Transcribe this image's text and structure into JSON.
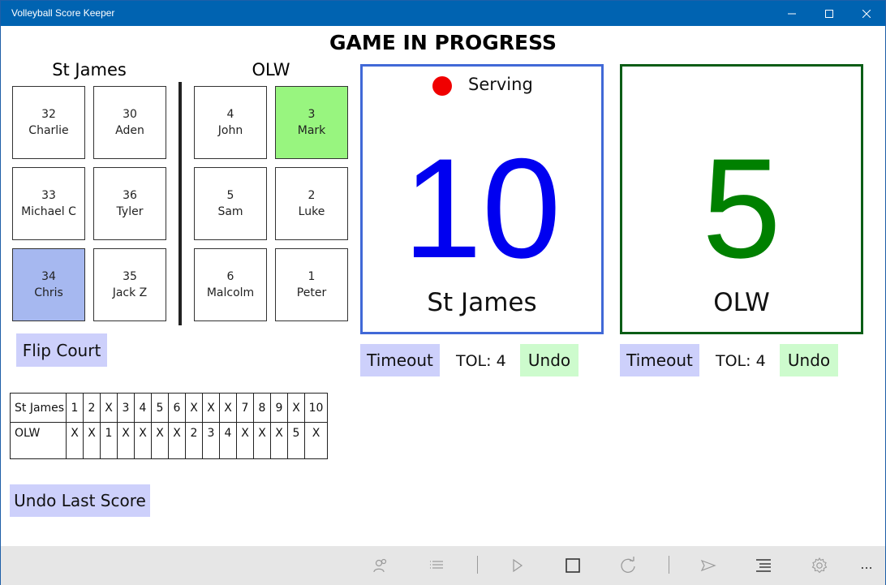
{
  "window": {
    "title": "Volleyball Score Keeper",
    "controls": {
      "minimize": "—",
      "maximize": "☐",
      "close": "✕"
    }
  },
  "header": {
    "title": "GAME IN PROGRESS"
  },
  "court": {
    "left_team": "St James",
    "right_team": "OLW",
    "left_players": [
      {
        "number": "32",
        "name": "Charlie"
      },
      {
        "number": "30",
        "name": "Aden"
      },
      {
        "number": "33",
        "name": "Michael C"
      },
      {
        "number": "36",
        "name": "Tyler"
      },
      {
        "number": "34",
        "name": "Chris"
      },
      {
        "number": "35",
        "name": "Jack Z"
      }
    ],
    "right_players": [
      {
        "number": "4",
        "name": "John"
      },
      {
        "number": "3",
        "name": "Mark"
      },
      {
        "number": "5",
        "name": "Sam"
      },
      {
        "number": "2",
        "name": "Luke"
      },
      {
        "number": "6",
        "name": "Malcolm"
      },
      {
        "number": "1",
        "name": "Peter"
      }
    ],
    "flip_label": "Flip Court"
  },
  "scores": {
    "left": {
      "team": "St James",
      "score": "10",
      "serving_label": "Serving",
      "timeout_label": "Timeout",
      "tol": "TOL: 4",
      "undo_label": "Undo",
      "color": "#0000f0"
    },
    "right": {
      "team": "OLW",
      "score": "5",
      "timeout_label": "Timeout",
      "tol": "TOL: 4",
      "undo_label": "Undo",
      "color": "#008000"
    }
  },
  "scoresheet": {
    "rows": [
      {
        "team": "St James",
        "cells": [
          "1",
          "2",
          "X",
          "3",
          "4",
          "5",
          "6",
          "X",
          "X",
          "X",
          "7",
          "8",
          "9",
          "X",
          "10"
        ]
      },
      {
        "team": "OLW",
        "cells": [
          "X",
          "X",
          "1",
          "X",
          "X",
          "X",
          "X",
          "2",
          "3",
          "4",
          "X",
          "X",
          "X",
          "5",
          "X"
        ]
      }
    ]
  },
  "undo_last_label": "Undo Last Score",
  "colors": {
    "titlebar": "#0063b1",
    "button_purple": "#cdd0fb",
    "button_green": "#cdfbcd",
    "serve_dot": "#f00000"
  },
  "appbar": {
    "icons": [
      "people-icon",
      "list-icon",
      "play-icon",
      "stop-icon",
      "refresh-icon",
      "send-icon",
      "menu-icon",
      "gear-icon",
      "more-icon"
    ],
    "more_label": "..."
  }
}
